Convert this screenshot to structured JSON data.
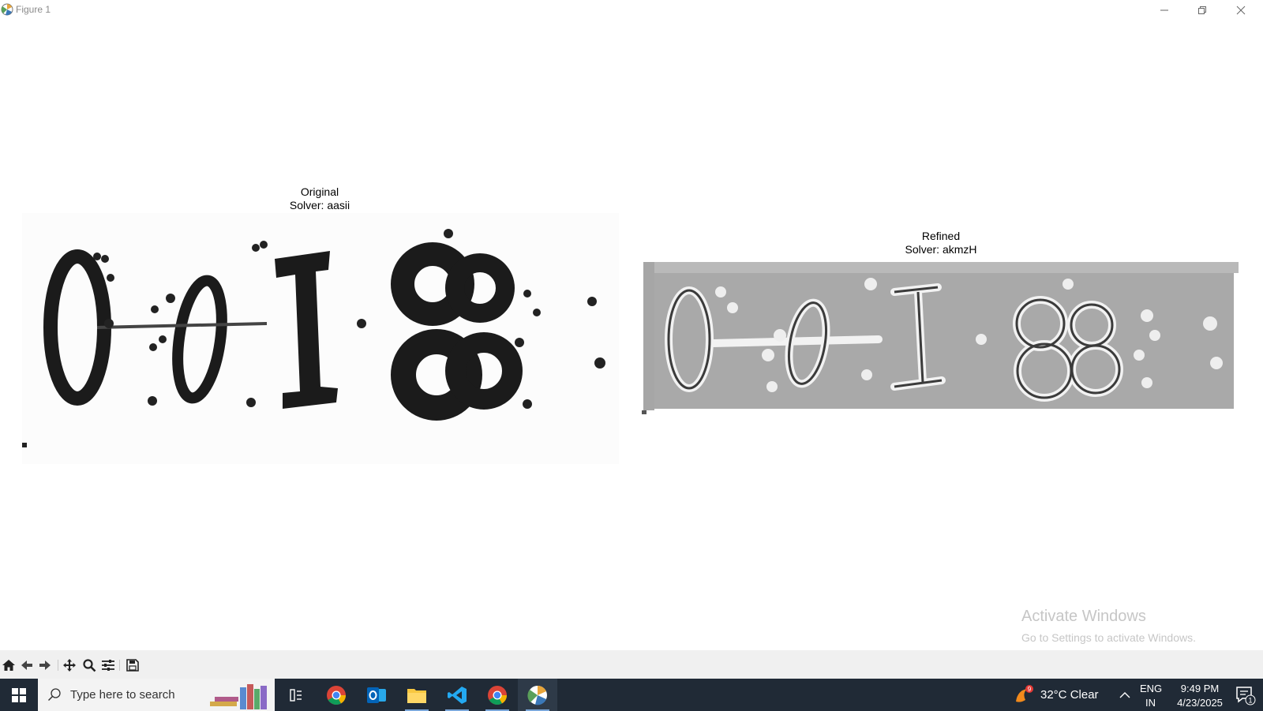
{
  "window": {
    "title": "Figure 1",
    "minimize": "minimize-icon",
    "maximize": "restore-icon",
    "close": "close-icon"
  },
  "figure": {
    "subplots": [
      {
        "title": "Original\nSolver: aasii",
        "image_text": "0·0·I·88"
      },
      {
        "title": "Refined\nSolver: akmzH",
        "image_text": "0·0·I·88"
      }
    ],
    "watermark": {
      "line1": "Activate Windows",
      "line2": "Go to Settings to activate Windows."
    }
  },
  "toolbar": {
    "buttons": [
      "home-icon",
      "back-icon",
      "forward-icon",
      "pan-icon",
      "zoom-icon",
      "configure-subplots-icon",
      "save-icon"
    ]
  },
  "taskbar": {
    "search_placeholder": "Type here to search",
    "apps": [
      "chrome-icon",
      "outlook-icon",
      "file-explorer-icon",
      "vscode-icon",
      "chrome-icon",
      "python-figure-icon"
    ],
    "weather": {
      "temp": "32°C",
      "condition": "Clear",
      "badge": "9"
    },
    "language": {
      "line1": "ENG",
      "line2": "IN"
    },
    "clock": {
      "time": "9:49 PM",
      "date": "4/23/2025"
    },
    "notifications_count": "1"
  }
}
